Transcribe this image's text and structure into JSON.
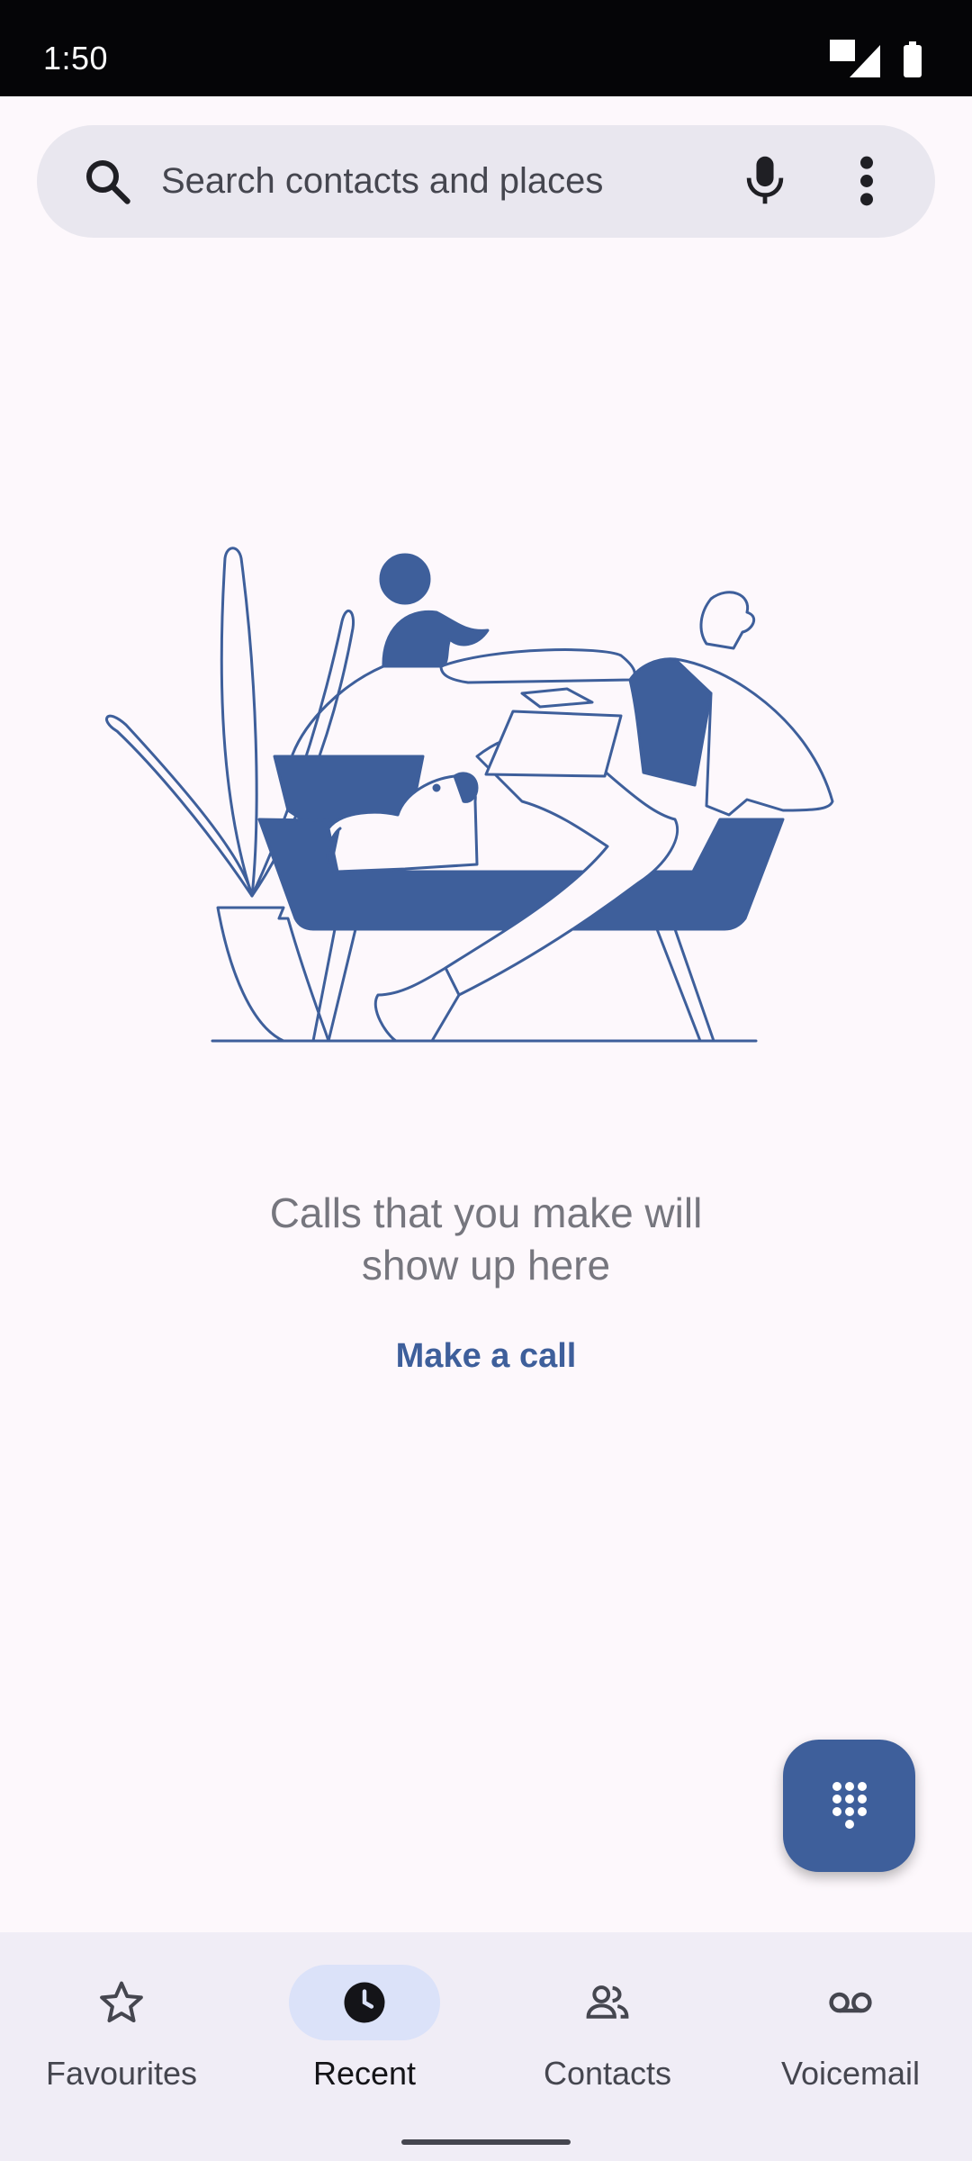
{
  "status_bar": {
    "time": "1:50"
  },
  "search": {
    "placeholder": "Search contacts and places"
  },
  "empty_state": {
    "message": "Calls that you make will\nshow up here",
    "action_label": "Make a call"
  },
  "fab": {
    "icon": "dialpad-icon"
  },
  "bottom_nav": {
    "items": [
      {
        "label": "Favourites",
        "icon": "star-icon",
        "active": false
      },
      {
        "label": "Recent",
        "icon": "clock-icon",
        "active": true
      },
      {
        "label": "Contacts",
        "icon": "people-icon",
        "active": false
      },
      {
        "label": "Voicemail",
        "icon": "voicemail-icon",
        "active": false
      }
    ]
  },
  "colors": {
    "background": "#fdf8fc",
    "accent": "#3e5f9b",
    "search_bar": "#e9e7ef",
    "nav_bar": "#f0edf6",
    "active_pill": "#dbe2f9"
  }
}
